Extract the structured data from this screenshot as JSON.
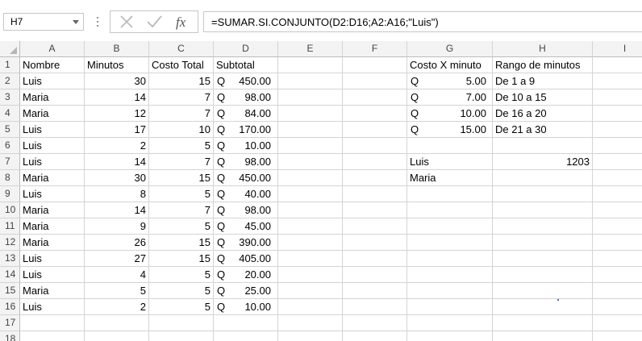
{
  "formula_bar": {
    "name_box": "H7",
    "formula": "=SUMAR.SI.CONJUNTO(D2:D16;A2:A16;\"Luis\")",
    "icons": [
      "dropdown-arrow-icon",
      "cancel-x-icon",
      "enter-check-icon",
      "fx-icon"
    ]
  },
  "columns": [
    "A",
    "B",
    "C",
    "D",
    "E",
    "F",
    "G",
    "H",
    "I"
  ],
  "rows": [
    "1",
    "2",
    "3",
    "4",
    "5",
    "6",
    "7",
    "8",
    "9",
    "10",
    "11",
    "12",
    "13",
    "14",
    "15",
    "16",
    "17",
    "18"
  ],
  "table": {
    "headers": [
      "Nombre",
      "Minutos",
      "Costo Total",
      "Subtotal"
    ],
    "rows": [
      [
        "Luis",
        "30",
        "15",
        "Q",
        "450.00"
      ],
      [
        "Maria",
        "14",
        "7",
        "Q",
        "98.00"
      ],
      [
        "Maria",
        "12",
        "7",
        "Q",
        "84.00"
      ],
      [
        "Luis",
        "17",
        "10",
        "Q",
        "170.00"
      ],
      [
        "Luis",
        "2",
        "5",
        "Q",
        "10.00"
      ],
      [
        "Luis",
        "14",
        "7",
        "Q",
        "98.00"
      ],
      [
        "Maria",
        "30",
        "15",
        "Q",
        "450.00"
      ],
      [
        "Luis",
        "8",
        "5",
        "Q",
        "40.00"
      ],
      [
        "Maria",
        "14",
        "7",
        "Q",
        "98.00"
      ],
      [
        "Maria",
        "9",
        "5",
        "Q",
        "45.00"
      ],
      [
        "Maria",
        "26",
        "15",
        "Q",
        "390.00"
      ],
      [
        "Luis",
        "27",
        "15",
        "Q",
        "405.00"
      ],
      [
        "Luis",
        "4",
        "5",
        "Q",
        "20.00"
      ],
      [
        "Maria",
        "5",
        "5",
        "Q",
        "25.00"
      ],
      [
        "Luis",
        "2",
        "5",
        "Q",
        "10.00"
      ]
    ]
  },
  "rates": {
    "headers": [
      "Costo X minuto",
      "Rango de minutos"
    ],
    "rows": [
      [
        "Q",
        "5.00",
        "De 1 a 9"
      ],
      [
        "Q",
        "7.00",
        "De 10 a 15"
      ],
      [
        "Q",
        "10.00",
        "De 16 a 20"
      ],
      [
        "Q",
        "15.00",
        "De 21 a 30"
      ]
    ]
  },
  "summary": [
    {
      "name": "Luis",
      "value": "1203"
    },
    {
      "name": "Maria",
      "value": ""
    }
  ]
}
